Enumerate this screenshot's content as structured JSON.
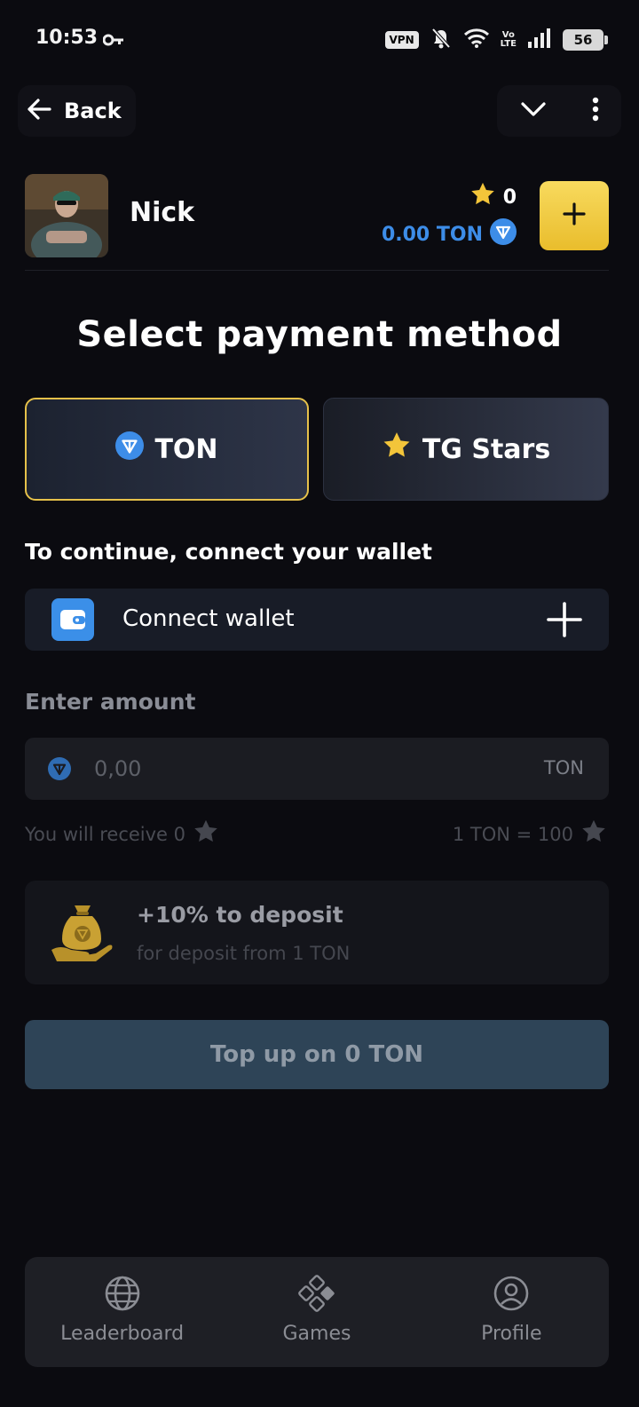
{
  "status_bar": {
    "time": "10:53",
    "vpn_label": "VPN",
    "volte_top": "Vo",
    "volte_bottom": "LTE",
    "battery": "56"
  },
  "nav": {
    "back_label": "Back"
  },
  "user": {
    "name": "Nick",
    "stars_balance": "0",
    "ton_balance": "0.00 TON"
  },
  "page": {
    "title": "Select payment method"
  },
  "methods": [
    {
      "label": "TON",
      "selected": true
    },
    {
      "label": "TG Stars",
      "selected": false
    }
  ],
  "wallet": {
    "section_label": "To continue, connect your wallet",
    "connect_label": "Connect wallet"
  },
  "amount": {
    "section_label": "Enter amount",
    "placeholder": "0,00",
    "currency": "TON",
    "receive_text": "You will receive 0",
    "rate_text": "1 TON = 100"
  },
  "bonus": {
    "title": "+10% to deposit",
    "subtitle": "for deposit from 1 TON"
  },
  "action": {
    "topup_label": "Top up on 0 TON"
  },
  "tabbar": {
    "items": [
      {
        "label": "Leaderboard",
        "icon": "globe-icon"
      },
      {
        "label": "Games",
        "icon": "gamepad-icon"
      },
      {
        "label": "Profile",
        "icon": "profile-icon"
      }
    ]
  },
  "colors": {
    "background": "#0b0b10",
    "accent_yellow": "#f3cd45",
    "ton_blue": "#3d8de8",
    "topup_disabled": "#2e4457"
  }
}
